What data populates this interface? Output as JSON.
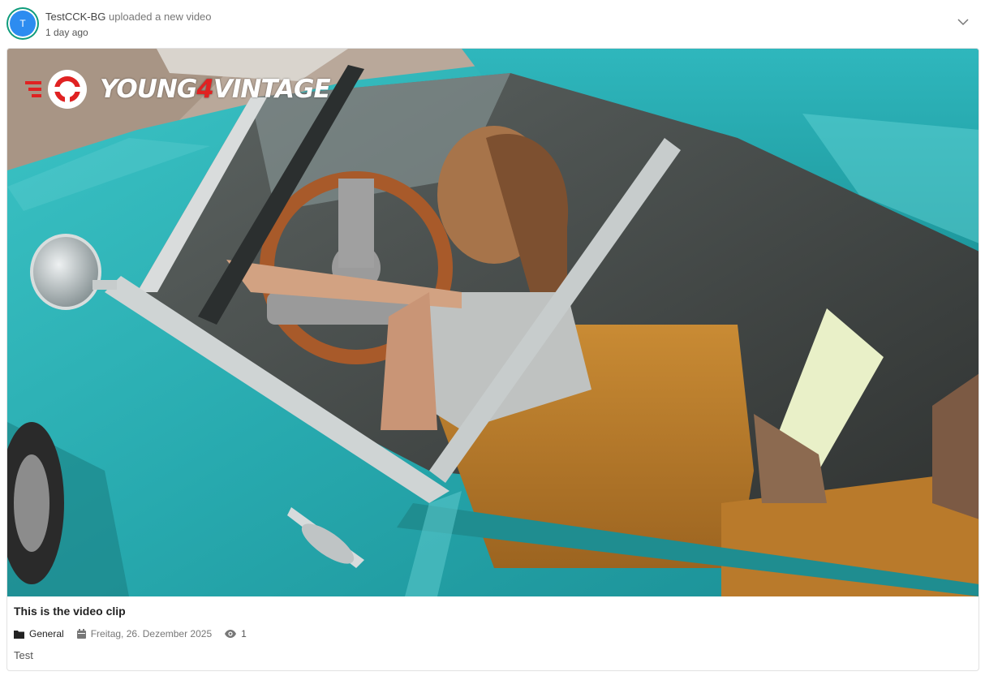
{
  "activity": {
    "avatar_initial": "T",
    "user_name": "TestCCK-BG",
    "action_text": "uploaded a new video",
    "time_ago": "1 day ago"
  },
  "video": {
    "logo_text_prefix": "YOUNG",
    "logo_text_number": "4",
    "logo_text_suffix": "VINTAGE",
    "title": "This is the video clip",
    "category": "General",
    "date": "Freitag, 26. Dezember 2025",
    "views": "1",
    "description": "Test"
  },
  "icons": {
    "collapse": "chevron-down-icon",
    "category": "folder-icon",
    "date": "calendar-icon",
    "views": "eye-icon"
  },
  "colors": {
    "avatar_ring": "#0f9c7c",
    "avatar_fill": "#2d8cf0",
    "car_turquoise": "#2bb3b7",
    "logo_red": "#e02222"
  }
}
